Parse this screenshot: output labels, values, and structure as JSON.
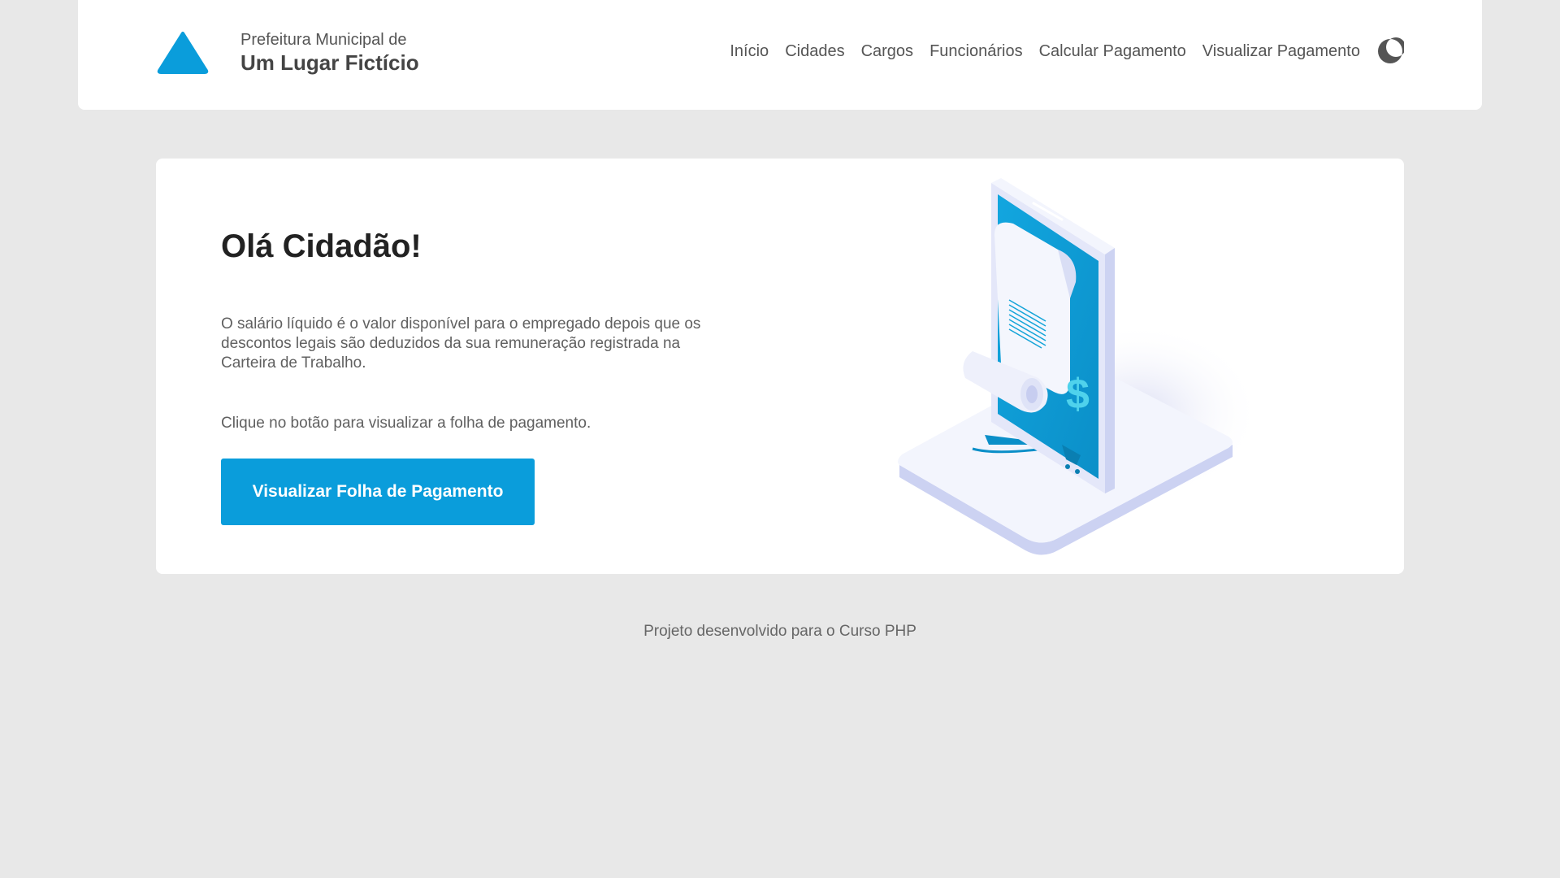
{
  "header": {
    "brand_line1": "Prefeitura Municipal de",
    "brand_line2": "Um Lugar Fictício",
    "logo_icon": "triangle-logo-icon",
    "nav": [
      {
        "label": "Início"
      },
      {
        "label": "Cidades"
      },
      {
        "label": "Cargos"
      },
      {
        "label": "Funcionários"
      },
      {
        "label": "Calcular Pagamento"
      },
      {
        "label": "Visualizar Pagamento"
      }
    ],
    "theme_icon": "moon-icon"
  },
  "hero": {
    "title": "Olá Cidadão!",
    "description": "O salário líquido é o valor disponível para o empregado depois que os descontos legais são deduzidos da sua remuneração registrada na Carteira de Trabalho.",
    "hint": "Clique no botão para visualizar a folha de pagamento.",
    "button_label": "Visualizar Folha de Pagamento",
    "illustration_icon": "payroll-receipt-phone-illustration"
  },
  "footer": {
    "text": "Projeto desenvolvido para o Curso PHP"
  },
  "colors": {
    "accent": "#0a9ddb",
    "background": "#e8e8e8",
    "surface": "#ffffff"
  }
}
